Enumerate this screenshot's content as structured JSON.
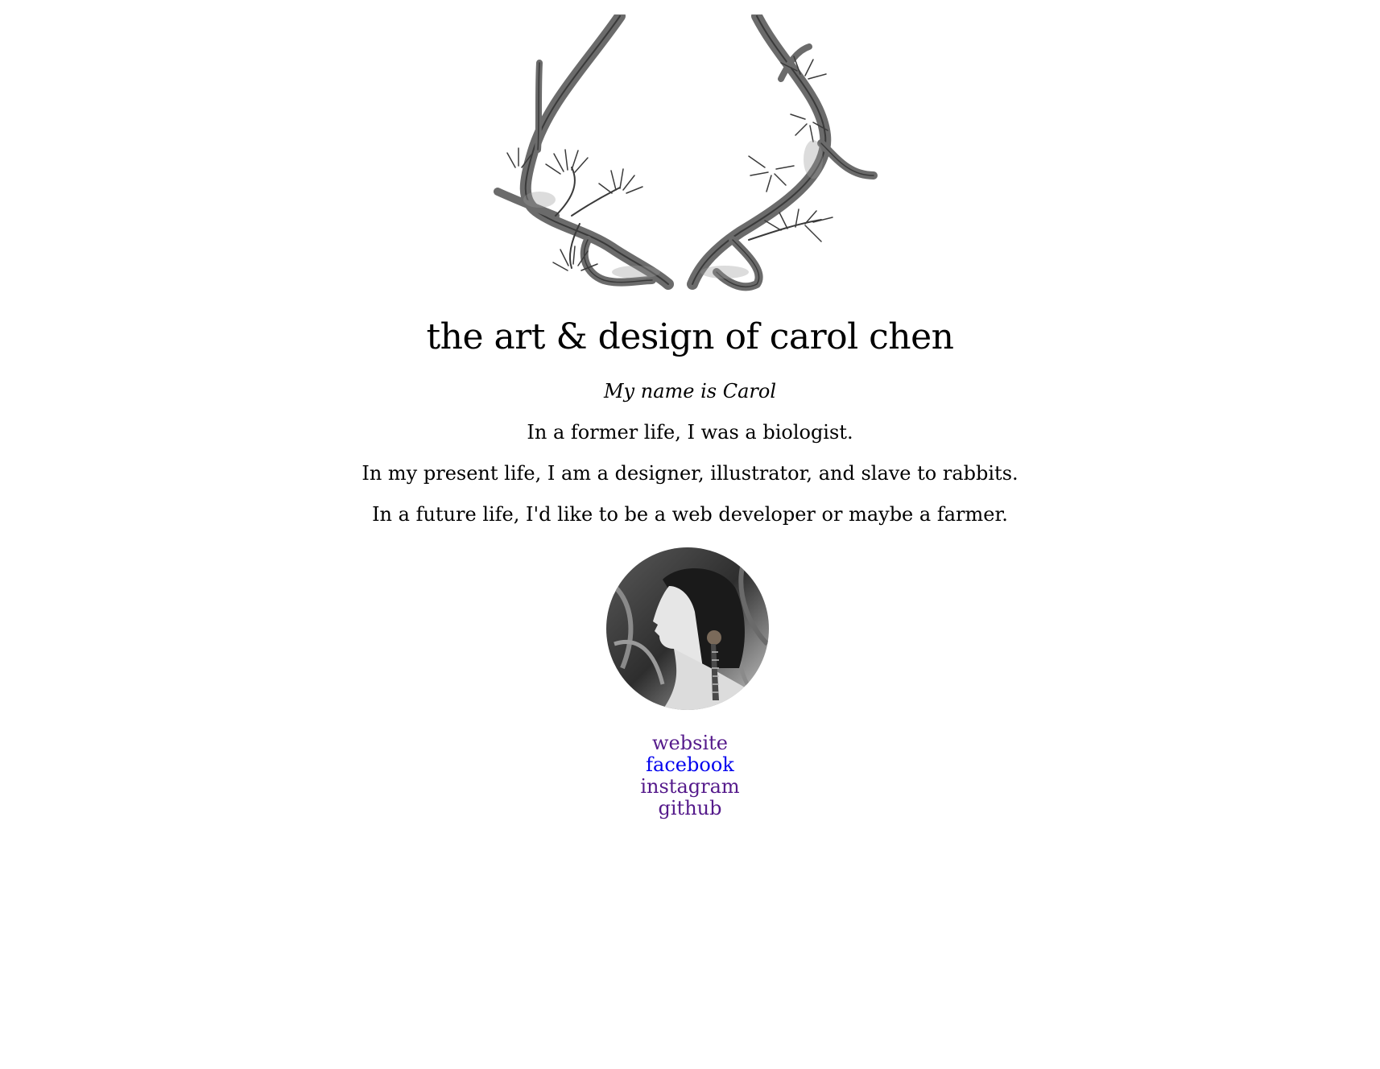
{
  "header": {
    "title": "the art & design of carol chen"
  },
  "intro": {
    "name_line": "My name is Carol",
    "past": "In a former life, I was a biologist.",
    "present": "In my present life, I am a designer, illustrator, and slave to rabbits.",
    "future": "In a future life, I'd like to be a web developer or maybe a farmer."
  },
  "images": {
    "header_art": "antlers-illustration",
    "avatar": "portrait-photo"
  },
  "links": [
    {
      "label": "website",
      "state": "visited"
    },
    {
      "label": "facebook",
      "state": "unvisited"
    },
    {
      "label": "instagram",
      "state": "visited"
    },
    {
      "label": "github",
      "state": "visited"
    }
  ],
  "colors": {
    "visited_link": "#551a8b",
    "unvisited_link": "#0000ee",
    "text": "#000000",
    "background": "#ffffff"
  }
}
